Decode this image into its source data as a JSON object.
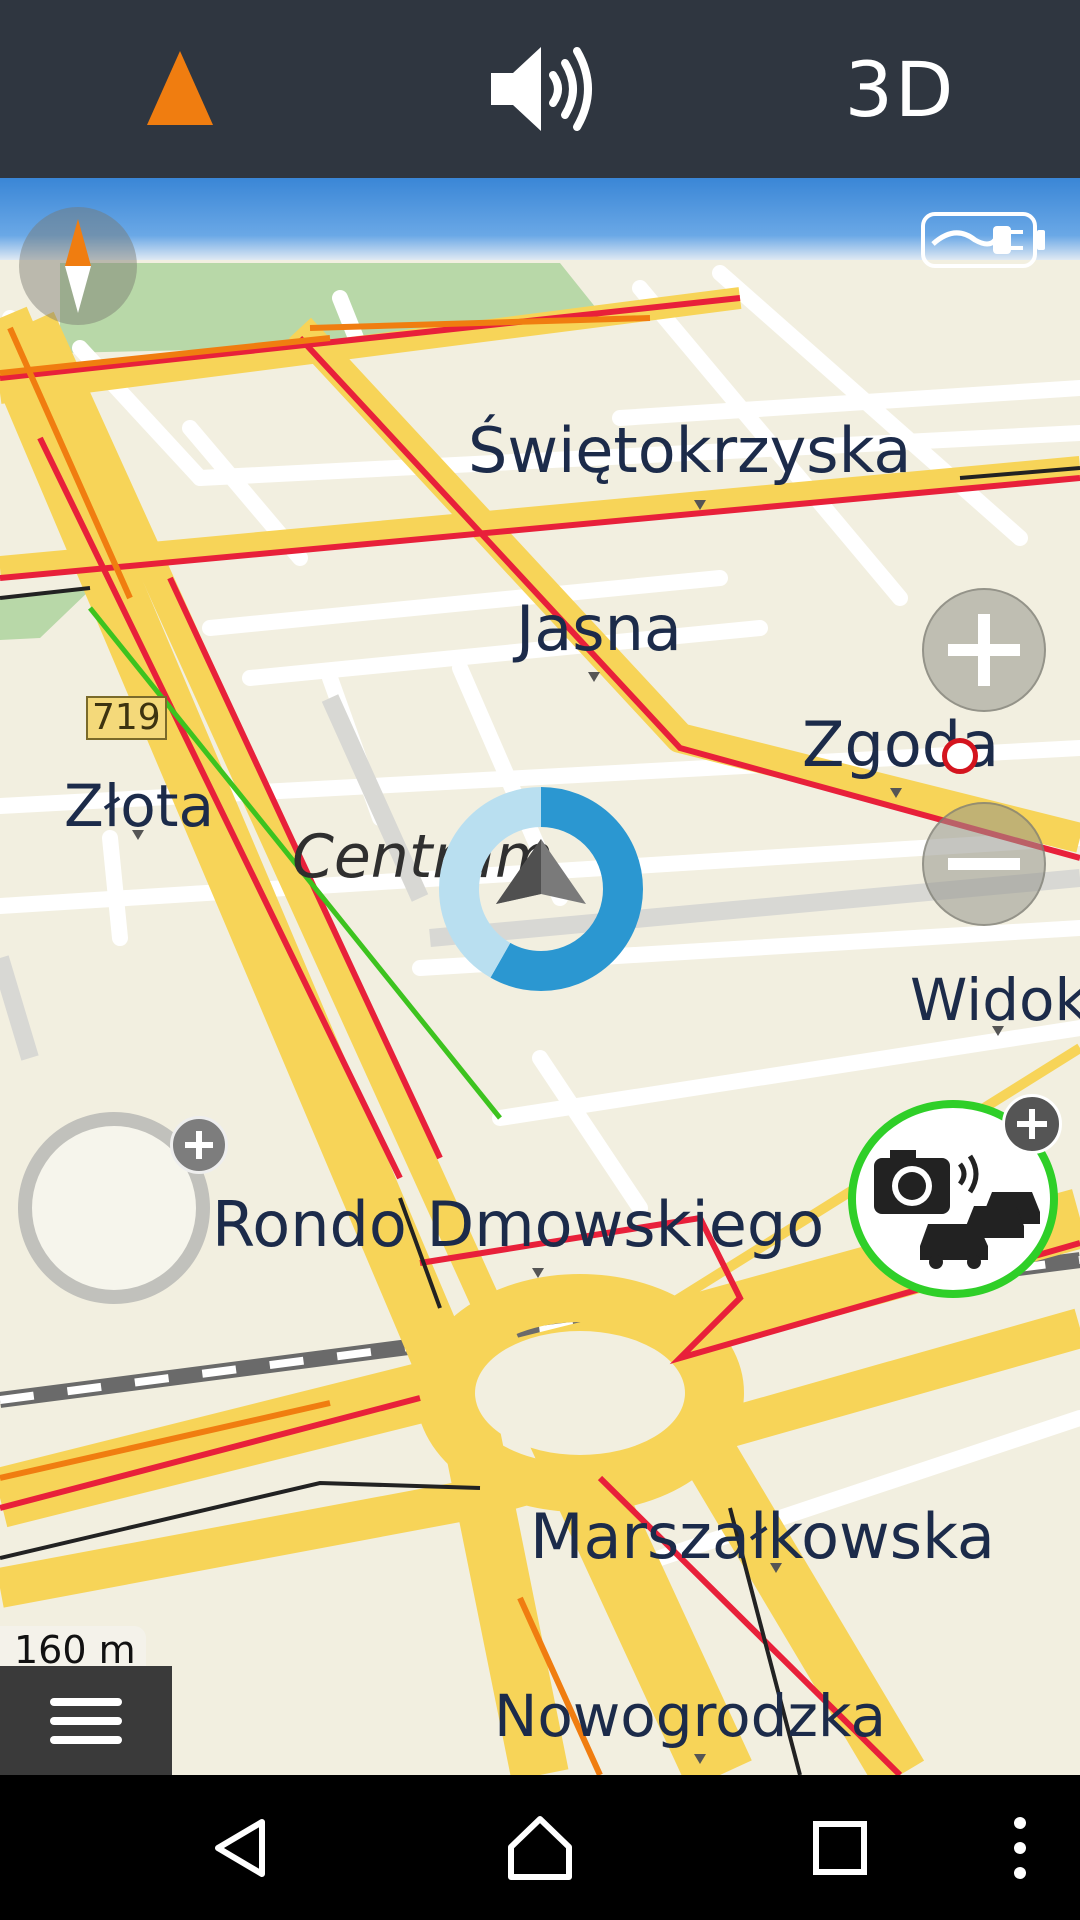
{
  "top_bar": {
    "compass_mode_icon": "navigation-arrow-icon",
    "sound_icon": "speaker-icon",
    "view_mode_label": "3D"
  },
  "map": {
    "labels": {
      "swietokrzyska": "Świętokrzyska",
      "jasna": "Jasna",
      "zgoda": "Zgoda",
      "zlota": "Złota",
      "centrum": "Centrum",
      "widok": "Widok",
      "rondo": "Rondo Dmowskiego",
      "marszalkowska": "Marszałkowska",
      "nowogrodzka": "Nowogrodzka"
    },
    "road_shield": "719",
    "scale": "160 m"
  },
  "controls": {
    "zoom_in_icon": "plus-icon",
    "zoom_out_icon": "minus-icon",
    "compass_icon": "compass-icon",
    "charging_icon": "charging-plug-icon",
    "menu_icon": "hamburger-menu-icon",
    "camera_icon": "speed-camera-traffic-icon"
  },
  "system_nav": {
    "back_icon": "back-icon",
    "home_icon": "home-icon",
    "recents_icon": "recents-icon",
    "more_icon": "more-vert-icon"
  },
  "colors": {
    "topbar_bg": "#2f3640",
    "accent_orange": "#f07d10",
    "road_yellow": "#f7d458",
    "traffic_red": "#e8203a",
    "camera_ring_green": "#2fcf28",
    "location_blue": "#2b97d1"
  }
}
